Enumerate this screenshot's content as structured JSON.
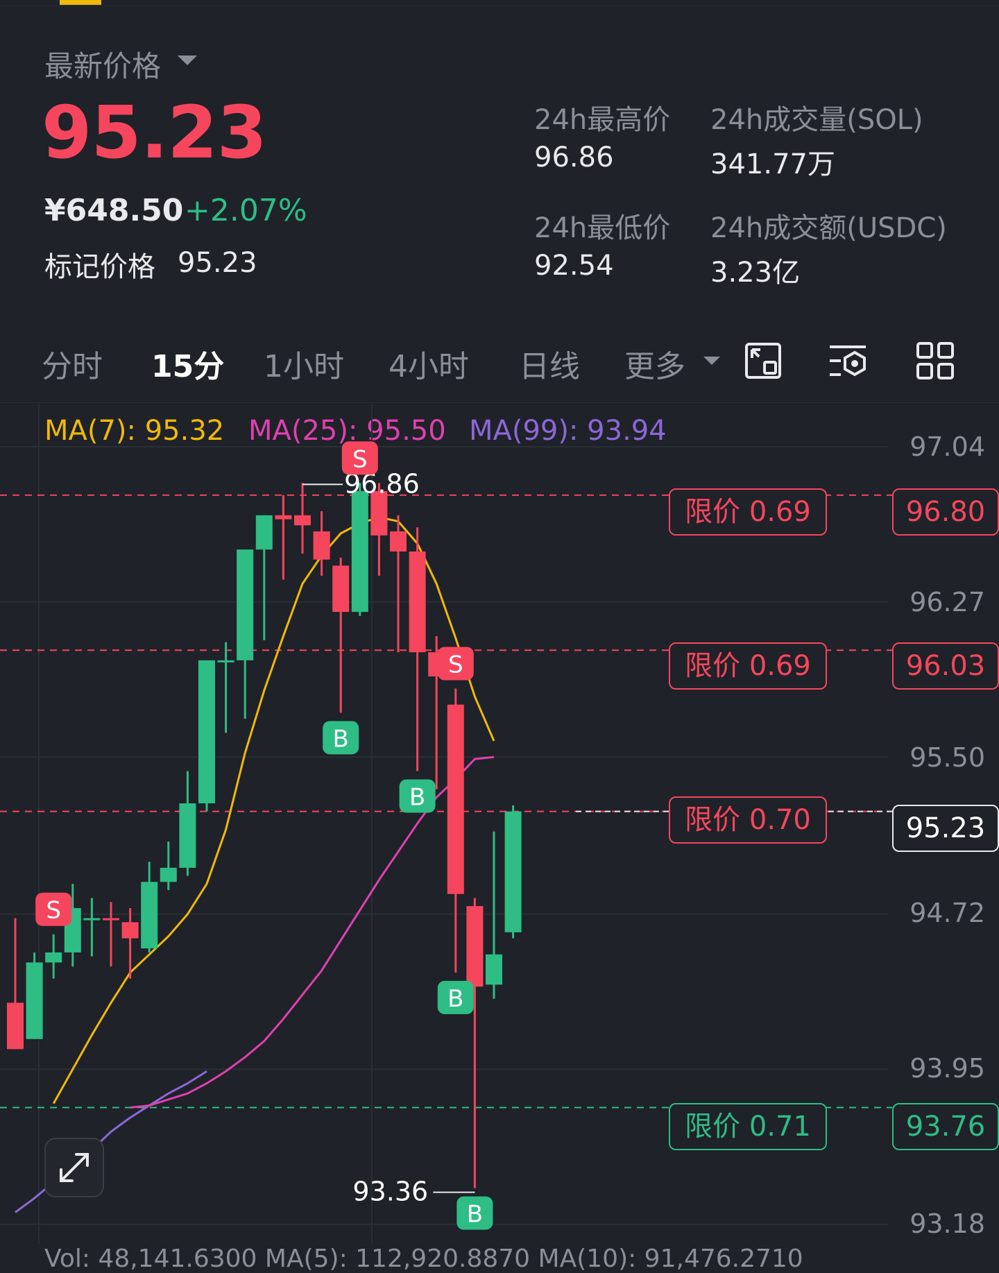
{
  "ticker": {
    "price_label": "最新价格",
    "last_price": "95.23",
    "cny_price": "¥648.50",
    "change_pct": "+2.07%",
    "mark_price_label": "标记价格",
    "mark_price_value": "95.23"
  },
  "stats": {
    "high_label": "24h最高价",
    "high_value": "96.86",
    "low_label": "24h最低价",
    "low_value": "92.54",
    "vol_label": "24h成交量(SOL)",
    "vol_value": "341.77万",
    "turnover_label": "24h成交额(USDC)",
    "turnover_value": "3.23亿"
  },
  "intervals": {
    "tabs": [
      "分时",
      "15分",
      "1小时",
      "4小时",
      "日线",
      "更多"
    ],
    "active": "15分"
  },
  "toolbar_icons": [
    "chart-settings-icon",
    "indicator-settings-icon",
    "grid-layout-icon"
  ],
  "indicators": {
    "ma7": "MA(7): 95.32",
    "ma25": "MA(25): 95.50",
    "ma99": "MA(99): 93.94"
  },
  "price_axis": [
    "97.04",
    "96.27",
    "95.50",
    "94.72",
    "93.95",
    "93.18"
  ],
  "orders": [
    {
      "label": "限价 0.69",
      "price": "96.80",
      "side": "sell"
    },
    {
      "label": "限价 0.69",
      "price": "96.03",
      "side": "sell"
    },
    {
      "label": "限价 0.70",
      "price": "95.23",
      "side": "sell"
    },
    {
      "label": "限价 0.71",
      "price": "93.76",
      "side": "buy"
    }
  ],
  "current_price_tag": "95.23",
  "annotations": {
    "high": "96.86",
    "low": "93.36"
  },
  "volume_line": "Vol: 48,141.6300    MA(5): 112,920.8870    MA(10): 91,476.2710",
  "colors": {
    "up": "#2ebd85",
    "down": "#f6465d",
    "ma7": "#f0b90b",
    "ma25": "#e040b0",
    "ma99": "#8b68d8"
  },
  "chart_data": {
    "type": "candlestick",
    "interval": "15分",
    "ylim": [
      93.18,
      97.04
    ],
    "candles": [
      {
        "o": 94.28,
        "h": 94.7,
        "l": 94.05,
        "c": 94.05
      },
      {
        "o": 94.1,
        "h": 94.53,
        "l": 94.1,
        "c": 94.48
      },
      {
        "o": 94.48,
        "h": 94.62,
        "l": 94.4,
        "c": 94.53
      },
      {
        "o": 94.53,
        "h": 94.87,
        "l": 94.46,
        "c": 94.75
      },
      {
        "o": 94.7,
        "h": 94.8,
        "l": 94.51,
        "c": 94.7
      },
      {
        "o": 94.7,
        "h": 94.78,
        "l": 94.46,
        "c": 94.69
      },
      {
        "o": 94.68,
        "h": 94.75,
        "l": 94.4,
        "c": 94.6
      },
      {
        "o": 94.55,
        "h": 94.98,
        "l": 94.53,
        "c": 94.88
      },
      {
        "o": 94.88,
        "h": 95.08,
        "l": 94.84,
        "c": 94.95
      },
      {
        "o": 94.95,
        "h": 95.43,
        "l": 94.91,
        "c": 95.27
      },
      {
        "o": 95.27,
        "h": 95.92,
        "l": 95.23,
        "c": 95.98
      },
      {
        "o": 95.98,
        "h": 96.07,
        "l": 95.62,
        "c": 95.98
      },
      {
        "o": 95.98,
        "h": 96.53,
        "l": 95.69,
        "c": 96.53
      },
      {
        "o": 96.53,
        "h": 96.7,
        "l": 96.08,
        "c": 96.7
      },
      {
        "o": 96.7,
        "h": 96.8,
        "l": 96.38,
        "c": 96.68
      },
      {
        "o": 96.7,
        "h": 96.86,
        "l": 96.51,
        "c": 96.65
      },
      {
        "o": 96.62,
        "h": 96.72,
        "l": 96.4,
        "c": 96.48
      },
      {
        "o": 96.45,
        "h": 96.49,
        "l": 95.72,
        "c": 96.22
      },
      {
        "o": 96.22,
        "h": 96.86,
        "l": 96.2,
        "c": 96.82
      },
      {
        "o": 96.82,
        "h": 96.86,
        "l": 96.4,
        "c": 96.6
      },
      {
        "o": 96.62,
        "h": 96.7,
        "l": 96.02,
        "c": 96.52
      },
      {
        "o": 96.52,
        "h": 96.64,
        "l": 95.43,
        "c": 96.02
      },
      {
        "o": 96.02,
        "h": 96.1,
        "l": 95.34,
        "c": 95.9
      },
      {
        "o": 95.76,
        "h": 95.84,
        "l": 94.43,
        "c": 94.82
      },
      {
        "o": 94.76,
        "h": 94.8,
        "l": 93.36,
        "c": 94.36
      },
      {
        "o": 94.37,
        "h": 95.13,
        "l": 94.3,
        "c": 94.52
      },
      {
        "o": 94.63,
        "h": 95.26,
        "l": 94.6,
        "c": 95.23
      }
    ],
    "markers": [
      {
        "index": 2,
        "type": "S"
      },
      {
        "index": 17,
        "type": "B"
      },
      {
        "index": 18,
        "type": "S"
      },
      {
        "index": 21,
        "type": "B"
      },
      {
        "index": 23,
        "type": "S"
      },
      {
        "index": 23,
        "type": "B"
      },
      {
        "index": 24,
        "type": "B"
      }
    ],
    "ma7": [
      93.78,
      93.95,
      94.12,
      94.28,
      94.43,
      94.52,
      94.61,
      94.72,
      94.87,
      95.14,
      95.52,
      95.83,
      96.1,
      96.36,
      96.5,
      96.61,
      96.66,
      96.69,
      96.67,
      96.56,
      96.36,
      96.09,
      95.8,
      95.58
    ],
    "ma25": [
      93.76,
      93.77,
      93.8,
      93.83,
      93.88,
      93.94,
      94.01,
      94.09,
      94.2,
      94.32,
      94.44,
      94.59,
      94.74,
      94.89,
      95.03,
      95.17,
      95.3,
      95.39,
      95.49,
      95.5
    ],
    "ma99": [
      93.24,
      93.31,
      93.39,
      93.47,
      93.55,
      93.64,
      93.71,
      93.77,
      93.83,
      93.88,
      93.94
    ]
  }
}
